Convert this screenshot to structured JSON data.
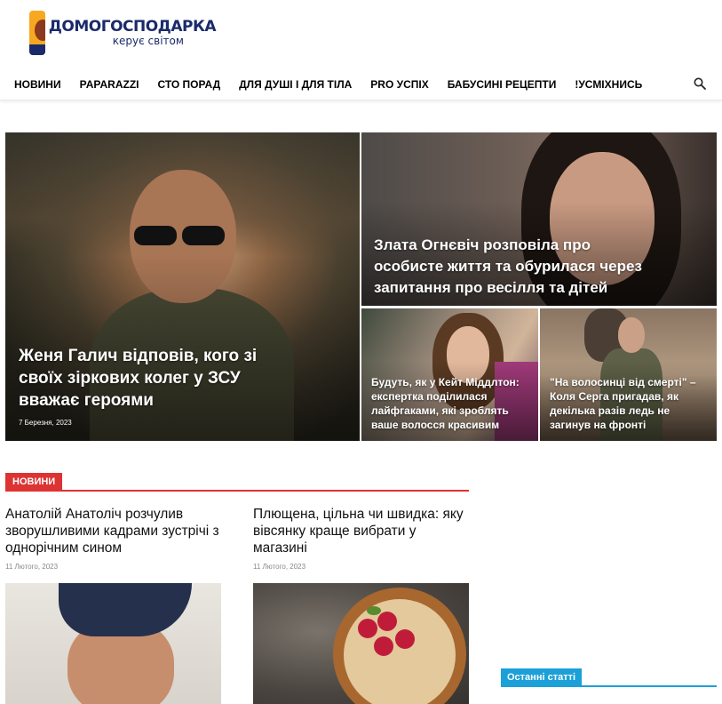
{
  "logo": {
    "main_text": "ДОМОГОСПОДАРКА",
    "sub_text": "керує світом"
  },
  "nav": {
    "items": [
      {
        "label": "НОВИНИ"
      },
      {
        "label": "PAPARAZZI"
      },
      {
        "label": "СТО ПОРАД"
      },
      {
        "label": "ДЛЯ ДУШІ І ДЛЯ ТІЛА"
      },
      {
        "label": "PRO УСПІХ"
      },
      {
        "label": "БАБУСИНІ РЕЦЕПТИ"
      },
      {
        "label": "!УСМІХНИСЬ"
      }
    ]
  },
  "featured": {
    "main": {
      "title": "Женя Галич відповів, кого зі своїх зіркових колег у ЗСУ вважає героями",
      "date": "7 Березня, 2023"
    },
    "top_right": {
      "title": "Злата Огнєвіч розповіла про особисте життя та обурилася через запитання про весілля та дітей"
    },
    "bottom_left": {
      "title": "Будуть, як у Кейт Міддлтон: експертка поділилася лайфгаками, які зроблять ваше волосся красивим"
    },
    "bottom_right": {
      "title": "\"На волосинці від смерті\" – Коля Серга пригадав, як декілька разів ледь не загинув на фронті"
    }
  },
  "news_section": {
    "label": "НОВИНИ",
    "articles": [
      {
        "title": "Анатолій Анатоліч розчулив зворушливими кадрами зустрічі з однорічним сином",
        "date": "11 Лютого, 2023"
      },
      {
        "title": "Плющена, цільна чи швидка: яку вівсянку краще вибрати у магазині",
        "date": "11 Лютого, 2023"
      }
    ]
  },
  "sidebar": {
    "label": "Останні статті"
  },
  "colors": {
    "section_accent": "#dd3333",
    "sidebar_accent": "#1ba0d8",
    "logo_navy": "#1a2a6b"
  }
}
